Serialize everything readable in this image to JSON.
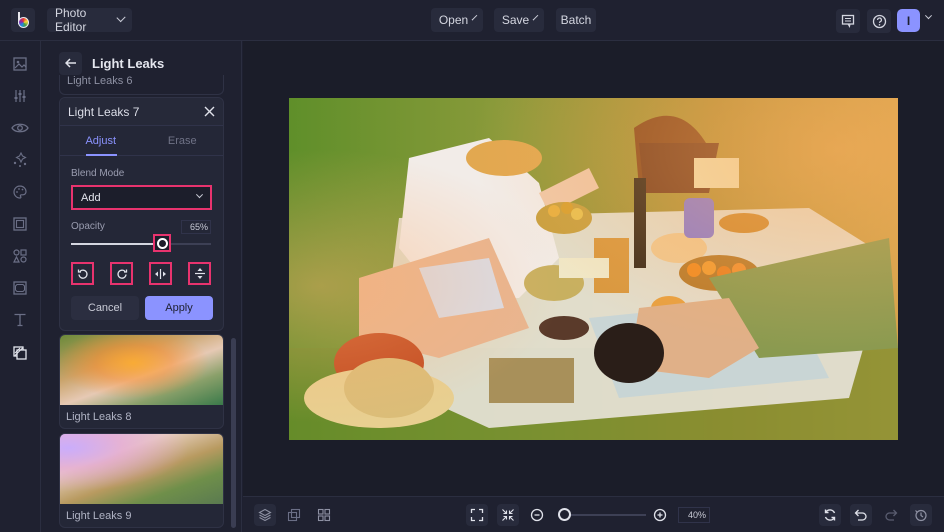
{
  "topbar": {
    "app_menu_label": "Photo Editor",
    "open_label": "Open",
    "save_label": "Save",
    "batch_label": "Batch",
    "avatar_initial": "I"
  },
  "sidebar": {
    "items": [
      {
        "name": "image-icon"
      },
      {
        "name": "adjust-sliders-icon"
      },
      {
        "name": "eye-icon"
      },
      {
        "name": "sparkles-icon"
      },
      {
        "name": "palette-icon"
      },
      {
        "name": "frame-icon"
      },
      {
        "name": "shapes-icon"
      },
      {
        "name": "texture-icon"
      },
      {
        "name": "text-icon"
      },
      {
        "name": "overlay-icon",
        "active": true
      }
    ]
  },
  "panel": {
    "title": "Light Leaks",
    "previous_item": "Light Leaks 6",
    "active_item": {
      "title": "Light Leaks 7",
      "tabs": [
        {
          "label": "Adjust",
          "active": true
        },
        {
          "label": "Erase",
          "active": false
        }
      ],
      "blend_mode_label": "Blend Mode",
      "blend_mode_value": "Add",
      "opacity_label": "Opacity",
      "opacity_value": "65%",
      "opacity_fraction": 0.65,
      "tools": [
        "rotate-left-icon",
        "rotate-right-icon",
        "flip-horizontal-icon",
        "flip-vertical-icon"
      ],
      "cancel_label": "Cancel",
      "apply_label": "Apply"
    },
    "items": [
      {
        "label": "Light Leaks 8"
      },
      {
        "label": "Light Leaks 9"
      }
    ]
  },
  "bottombar": {
    "zoom_value": "40%",
    "zoom_fraction": 0.05
  },
  "colors": {
    "accent": "#8b93ff",
    "highlight": "#e8336e",
    "background": "#1e2030"
  }
}
